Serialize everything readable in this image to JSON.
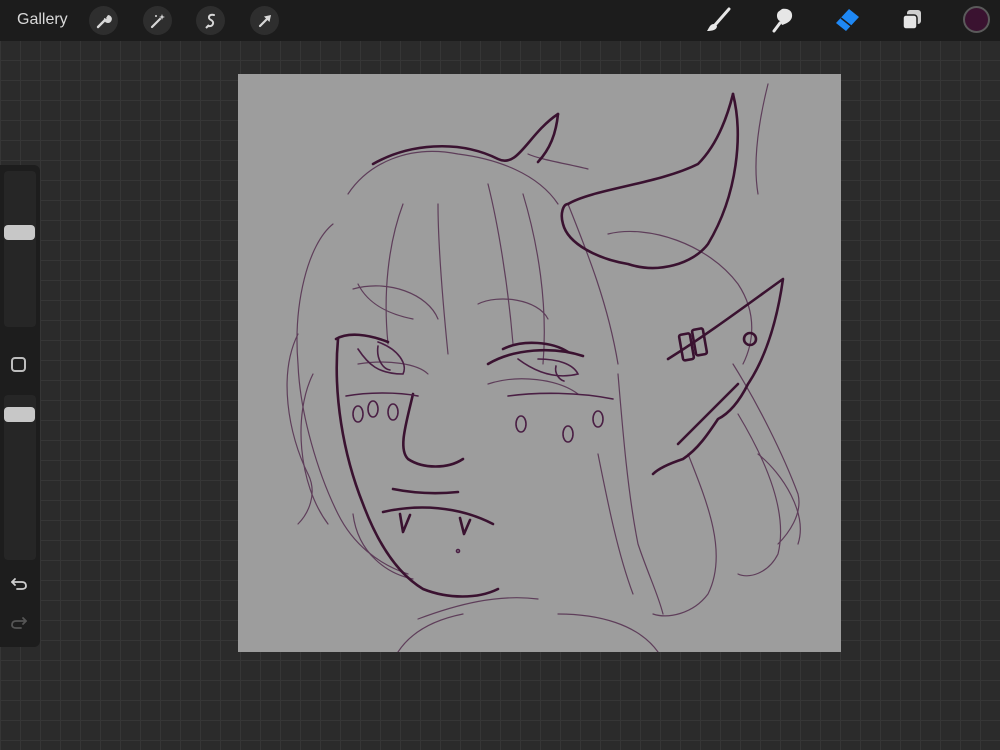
{
  "topbar": {
    "gallery_label": "Gallery",
    "left_tools": [
      "wrench-icon",
      "magic-wand-icon",
      "selection-icon",
      "transform-arrow-icon"
    ],
    "right_tools": [
      "brush-icon",
      "smudge-icon",
      "eraser-icon",
      "layers-icon"
    ],
    "active_tool": "eraser",
    "current_color": "#3a1230"
  },
  "colors": {
    "accent": "#1e88f5",
    "sketch_stroke": "#4a1f44"
  },
  "sidebar": {
    "brush_size_level": 0.62,
    "opacity_level": 0.92,
    "buttons": [
      "modify-button",
      "undo-icon",
      "redo-icon"
    ]
  }
}
